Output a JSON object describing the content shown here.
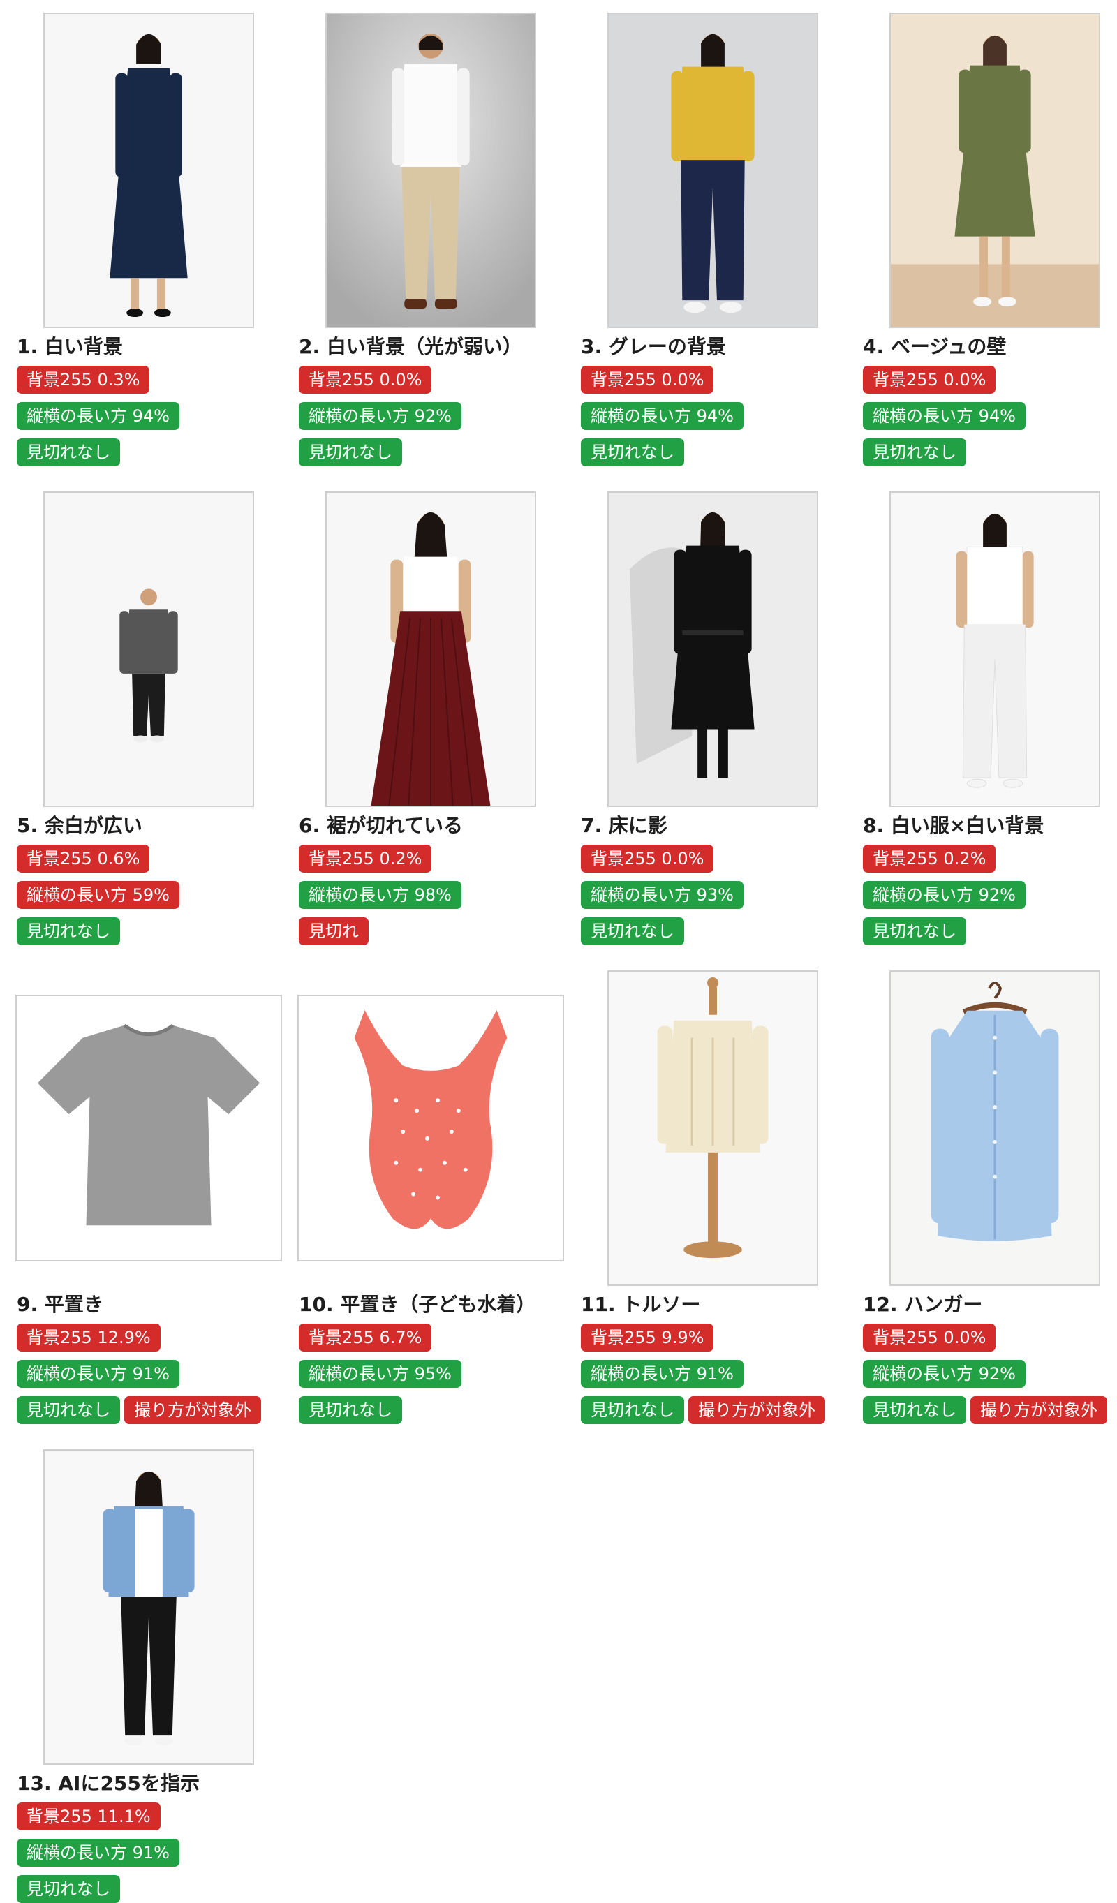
{
  "colors": {
    "red": "#d42b2b",
    "green": "#22a044"
  },
  "cards": [
    {
      "title": "1. 白い背景",
      "bg": "背景255 0.3%",
      "bg_status": "red",
      "ratio": "縦横の長い方 94%",
      "ratio_status": "green",
      "crop": "見切れなし",
      "crop_status": "green",
      "extra": "",
      "image": "woman-navy-dress",
      "layout": "portrait"
    },
    {
      "title": "2. 白い背景（光が弱い）",
      "bg": "背景255 0.0%",
      "bg_status": "red",
      "ratio": "縦横の長い方 92%",
      "ratio_status": "green",
      "crop": "見切れなし",
      "crop_status": "green",
      "extra": "",
      "image": "man-white-shirt-khaki",
      "layout": "portrait"
    },
    {
      "title": "3. グレーの背景",
      "bg": "背景255 0.0%",
      "bg_status": "red",
      "ratio": "縦横の長い方 94%",
      "ratio_status": "green",
      "crop": "見切れなし",
      "crop_status": "green",
      "extra": "",
      "image": "woman-yellow-sweater-navy-pants",
      "layout": "portrait"
    },
    {
      "title": "4. ベージュの壁",
      "bg": "背景255 0.0%",
      "bg_status": "red",
      "ratio": "縦横の長い方 94%",
      "ratio_status": "green",
      "crop": "見切れなし",
      "crop_status": "green",
      "extra": "",
      "image": "woman-olive-shirt-dress",
      "layout": "portrait"
    },
    {
      "title": "5. 余白が広い",
      "bg": "背景255 0.6%",
      "bg_status": "red",
      "ratio": "縦横の長い方 59%",
      "ratio_status": "red",
      "crop": "見切れなし",
      "crop_status": "green",
      "extra": "",
      "image": "man-gray-hoodie-small",
      "layout": "portrait"
    },
    {
      "title": "6. 裾が切れている",
      "bg": "背景255 0.2%",
      "bg_status": "red",
      "ratio": "縦横の長い方 98%",
      "ratio_status": "green",
      "crop": "見切れ",
      "crop_status": "red",
      "extra": "",
      "image": "woman-maroon-pleated-skirt",
      "layout": "portrait"
    },
    {
      "title": "7. 床に影",
      "bg": "背景255 0.0%",
      "bg_status": "red",
      "ratio": "縦横の長い方 93%",
      "ratio_status": "green",
      "crop": "見切れなし",
      "crop_status": "green",
      "extra": "",
      "image": "woman-black-trench-coat-shadow",
      "layout": "portrait"
    },
    {
      "title": "8. 白い服×白い背景",
      "bg": "背景255 0.2%",
      "bg_status": "red",
      "ratio": "縦横の長い方 92%",
      "ratio_status": "green",
      "crop": "見切れなし",
      "crop_status": "green",
      "extra": "",
      "image": "woman-white-tee-white-pants",
      "layout": "portrait"
    },
    {
      "title": "9. 平置き",
      "bg": "背景255 12.9%",
      "bg_status": "red",
      "ratio": "縦横の長い方 91%",
      "ratio_status": "green",
      "crop": "見切れなし",
      "crop_status": "green",
      "extra": "撮り方が対象外",
      "image": "gray-tshirt-flat",
      "layout": "flat"
    },
    {
      "title": "10. 平置き（子ども水着）",
      "bg": "背景255 6.7%",
      "bg_status": "red",
      "ratio": "縦横の長い方 95%",
      "ratio_status": "green",
      "crop": "見切れなし",
      "crop_status": "green",
      "extra": "",
      "image": "coral-polka-dot-swimsuit",
      "layout": "flat"
    },
    {
      "title": "11. トルソー",
      "bg": "背景255 9.9%",
      "bg_status": "red",
      "ratio": "縦横の長い方 91%",
      "ratio_status": "green",
      "crop": "見切れなし",
      "crop_status": "green",
      "extra": "撮り方が対象外",
      "image": "cream-cable-sweater-torso",
      "layout": "portrait"
    },
    {
      "title": "12. ハンガー",
      "bg": "背景255 0.0%",
      "bg_status": "red",
      "ratio": "縦横の長い方 92%",
      "ratio_status": "green",
      "crop": "見切れなし",
      "crop_status": "green",
      "extra": "撮り方が対象外",
      "image": "blue-shirt-hanger",
      "layout": "portrait"
    },
    {
      "title": "13. AIに255を指示",
      "bg": "背景255 11.1%",
      "bg_status": "red",
      "ratio": "縦横の長い方 91%",
      "ratio_status": "green",
      "crop": "見切れなし",
      "crop_status": "green",
      "extra": "",
      "image": "woman-denim-jacket-black-jeans",
      "layout": "portrait"
    }
  ]
}
